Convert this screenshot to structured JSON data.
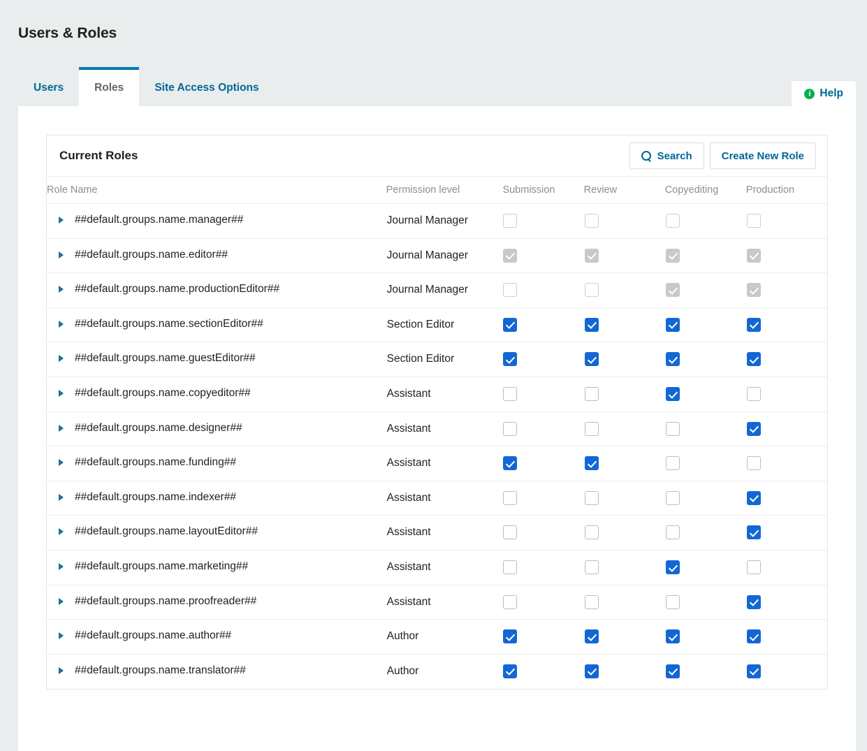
{
  "page": {
    "title": "Users & Roles"
  },
  "tabs": [
    {
      "label": "Users",
      "active": false
    },
    {
      "label": "Roles",
      "active": true
    },
    {
      "label": "Site Access Options",
      "active": false
    }
  ],
  "help": {
    "label": "Help",
    "icon": "info-icon"
  },
  "card": {
    "title": "Current Roles",
    "search_label": "Search",
    "search_icon": "search-icon",
    "create_label": "Create New Role"
  },
  "table": {
    "columns": [
      "Role Name",
      "Permission level",
      "Submission",
      "Review",
      "Copyediting",
      "Production"
    ],
    "rows": [
      {
        "name": "##default.groups.name.manager##",
        "permission": "Journal Manager",
        "stages": [
          "off-dis",
          "off-dis",
          "off-dis",
          "off-dis"
        ]
      },
      {
        "name": "##default.groups.name.editor##",
        "permission": "Journal Manager",
        "stages": [
          "on-dis",
          "on-dis",
          "on-dis",
          "on-dis"
        ]
      },
      {
        "name": "##default.groups.name.productionEditor##",
        "permission": "Journal Manager",
        "stages": [
          "off-dis",
          "off-dis",
          "on-dis",
          "on-dis"
        ]
      },
      {
        "name": "##default.groups.name.sectionEditor##",
        "permission": "Section Editor",
        "stages": [
          "on",
          "on",
          "on",
          "on"
        ]
      },
      {
        "name": "##default.groups.name.guestEditor##",
        "permission": "Section Editor",
        "stages": [
          "on",
          "on",
          "on",
          "on"
        ]
      },
      {
        "name": "##default.groups.name.copyeditor##",
        "permission": "Assistant",
        "stages": [
          "off",
          "off",
          "on",
          "off"
        ]
      },
      {
        "name": "##default.groups.name.designer##",
        "permission": "Assistant",
        "stages": [
          "off",
          "off",
          "off",
          "on"
        ]
      },
      {
        "name": "##default.groups.name.funding##",
        "permission": "Assistant",
        "stages": [
          "on",
          "on",
          "off",
          "off"
        ]
      },
      {
        "name": "##default.groups.name.indexer##",
        "permission": "Assistant",
        "stages": [
          "off",
          "off",
          "off",
          "on"
        ]
      },
      {
        "name": "##default.groups.name.layoutEditor##",
        "permission": "Assistant",
        "stages": [
          "off",
          "off",
          "off",
          "on"
        ]
      },
      {
        "name": "##default.groups.name.marketing##",
        "permission": "Assistant",
        "stages": [
          "off",
          "off",
          "on",
          "off"
        ]
      },
      {
        "name": "##default.groups.name.proofreader##",
        "permission": "Assistant",
        "stages": [
          "off",
          "off",
          "off",
          "on"
        ]
      },
      {
        "name": "##default.groups.name.author##",
        "permission": "Author",
        "stages": [
          "on",
          "on",
          "on",
          "on"
        ]
      },
      {
        "name": "##default.groups.name.translator##",
        "permission": "Author",
        "stages": [
          "on",
          "on",
          "on",
          "on"
        ]
      }
    ]
  },
  "colors": {
    "accent": "#006798",
    "tab_active_border": "#007ab2",
    "checkbox_on": "#1367d4",
    "checkbox_disabled": "#c8c8cd",
    "info_green": "#00b24e",
    "page_bg": "#e9edee"
  }
}
